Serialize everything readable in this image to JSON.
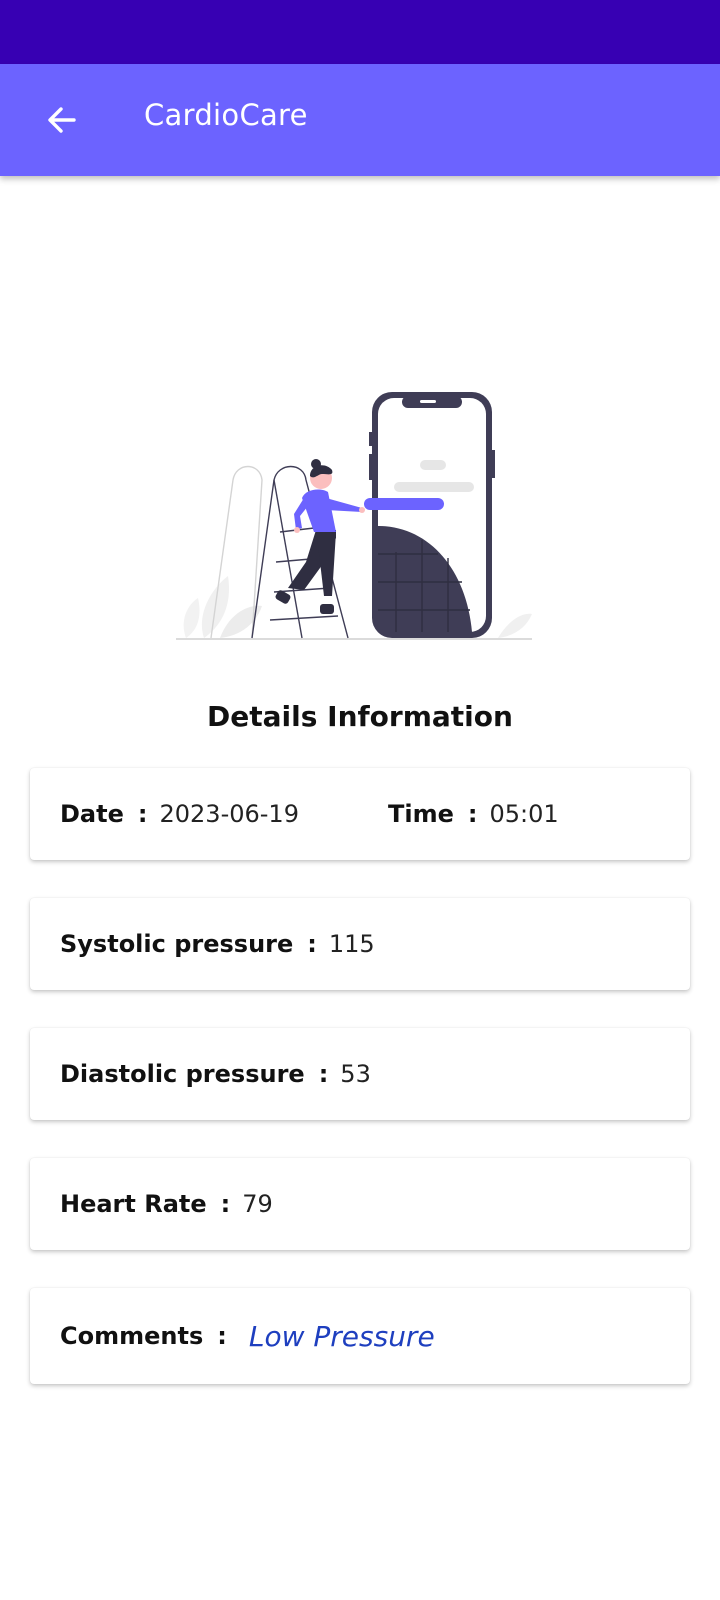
{
  "app_bar": {
    "title": "CardioCare",
    "back_icon": "arrow-left-icon"
  },
  "section_title": "Details Information",
  "details": {
    "date_label": "Date",
    "date_value": "2023-06-19",
    "time_label": "Time",
    "time_value": "05:01",
    "systolic_label": "Systolic pressure",
    "systolic_value": "115",
    "diastolic_label": "Diastolic pressure",
    "diastolic_value": "53",
    "heart_rate_label": "Heart Rate",
    "heart_rate_value": "79",
    "comments_label": "Comments",
    "comments_value": "Low Pressure",
    "separator": ":"
  },
  "colors": {
    "status_bar": "#3700B3",
    "app_bar": "#6C63FF",
    "comment_text": "#1E3FBF"
  }
}
